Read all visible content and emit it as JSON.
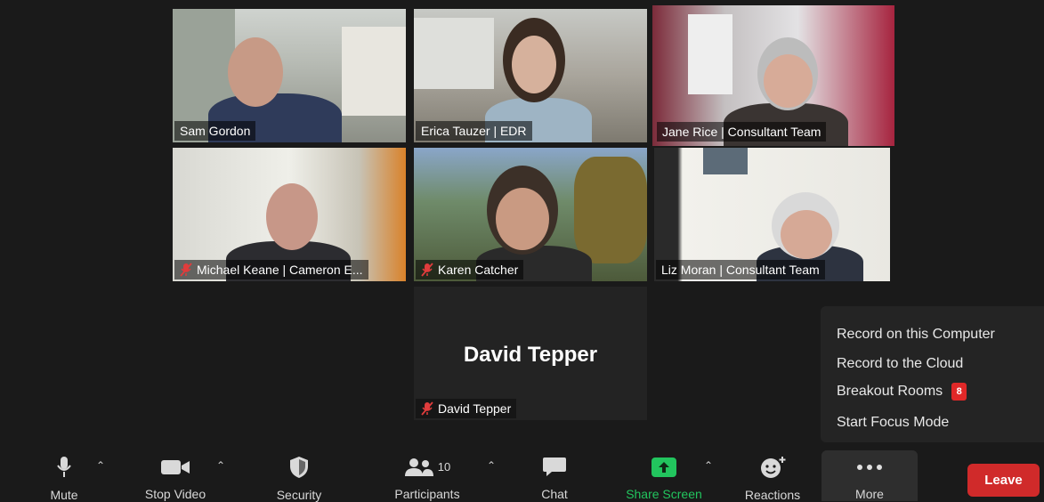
{
  "participants": [
    {
      "name": "Sam Gordon",
      "muted": false
    },
    {
      "name": "Erica Tauzer | EDR",
      "muted": false
    },
    {
      "name": "Jane Rice | Consultant Team",
      "muted": false,
      "active_speaker": true
    },
    {
      "name": "Michael Keane | Cameron E...",
      "muted": true
    },
    {
      "name": "Karen Catcher",
      "muted": true
    },
    {
      "name": "Liz Moran | Consultant Team",
      "muted": false
    }
  ],
  "video_off_participant": {
    "display_name": "David Tepper",
    "tag": "David Tepper",
    "muted": true
  },
  "more_menu": {
    "items": [
      "Record on this Computer",
      "Record to the Cloud",
      "Breakout Rooms",
      "Start Focus Mode"
    ],
    "breakout_badge": "8"
  },
  "toolbar": {
    "mute": "Mute",
    "stop_video": "Stop Video",
    "security": "Security",
    "participants": "Participants",
    "participants_count": "10",
    "chat": "Chat",
    "share_screen": "Share Screen",
    "reactions": "Reactions",
    "more": "More",
    "leave": "Leave"
  },
  "colors": {
    "active_speaker_border": "#c8e07a",
    "leave_button": "#d02a2a",
    "share_screen": "#22c55e",
    "badge": "#e02828"
  }
}
